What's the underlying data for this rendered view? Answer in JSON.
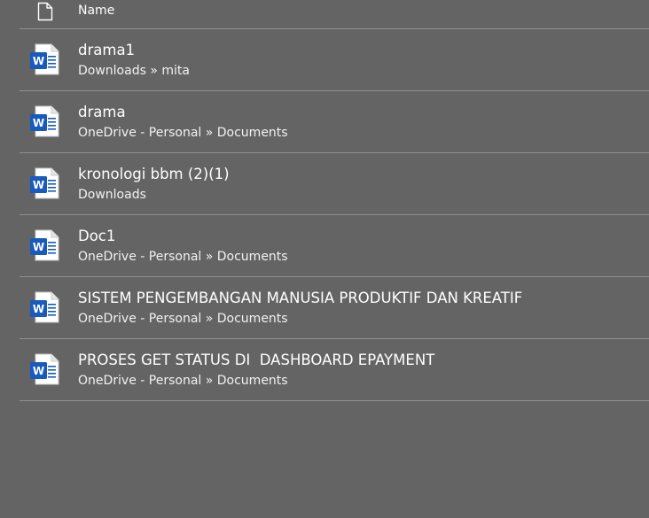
{
  "header": {
    "column_label": "Name",
    "icon": "document-outline-icon"
  },
  "files": [
    {
      "title": "drama1",
      "path": "Downloads » mita",
      "icon": "word-document-icon"
    },
    {
      "title": "drama",
      "path": "OneDrive - Personal » Documents",
      "icon": "word-document-icon"
    },
    {
      "title": "kronologi bbm (2)(1)",
      "path": "Downloads",
      "icon": "word-document-icon"
    },
    {
      "title": "Doc1",
      "path": "OneDrive - Personal » Documents",
      "icon": "word-document-icon"
    },
    {
      "title": "SISTEM PENGEMBANGAN MANUSIA PRODUKTIF DAN KREATIF",
      "path": "OneDrive - Personal » Documents",
      "icon": "word-document-icon"
    },
    {
      "title": "PROSES GET STATUS DI  DASHBOARD EPAYMENT",
      "path": "OneDrive - Personal » Documents",
      "icon": "word-document-icon"
    }
  ],
  "colors": {
    "background": "#646464",
    "divider": "#8f8f8f",
    "word_blue": "#185abd",
    "text": "#ffffff"
  }
}
